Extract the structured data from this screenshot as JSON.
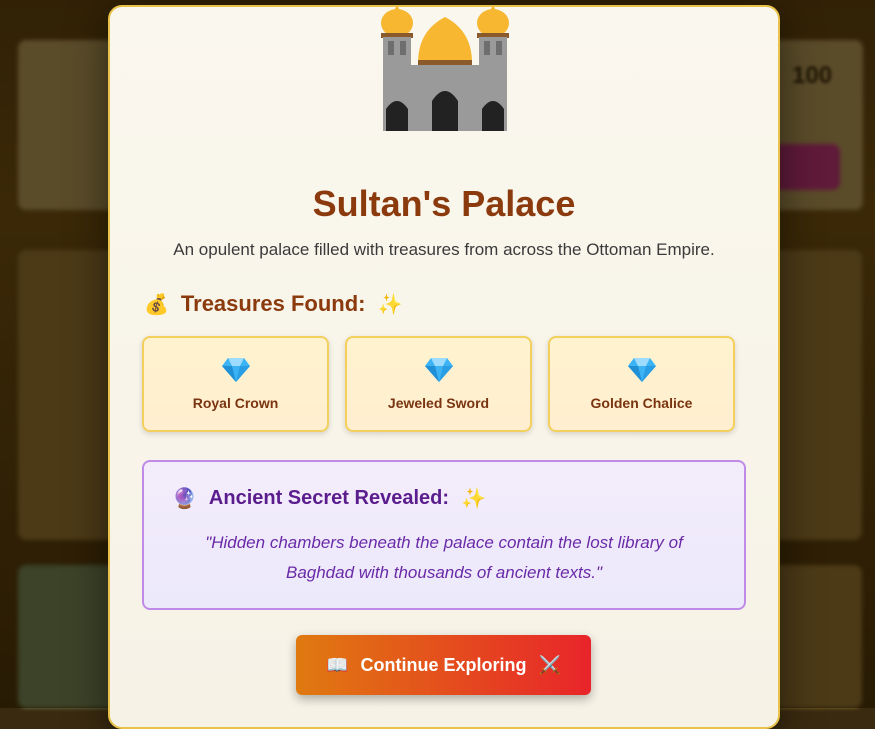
{
  "modal": {
    "title": "Sultan's Palace",
    "description": "An opulent palace filled with treasures from across the Ottoman Empire.",
    "treasures_heading": "Treasures Found:",
    "treasures_icon_left": "💰",
    "treasures_icon_right": "✨",
    "treasures": [
      {
        "label": "Royal Crown",
        "icon": "gem-icon"
      },
      {
        "label": "Jeweled Sword",
        "icon": "gem-icon"
      },
      {
        "label": "Golden Chalice",
        "icon": "gem-icon"
      }
    ],
    "secret_heading": "Ancient Secret Revealed:",
    "secret_icon_left": "🔮",
    "secret_icon_right": "✨",
    "secret_text": "\"Hidden chambers beneath the palace contain the lost library of Baghdad with thousands of ancient texts.\"",
    "continue_label": "Continue Exploring",
    "continue_icon_left": "📖",
    "continue_icon_right": "⚔️"
  },
  "background": {
    "score": "100"
  },
  "colors": {
    "title": "#8b3a0e",
    "border_gold": "#e8c24a",
    "secret_purple": "#5b1d8e",
    "cta_start": "#e07a10",
    "cta_end": "#e8242a"
  }
}
